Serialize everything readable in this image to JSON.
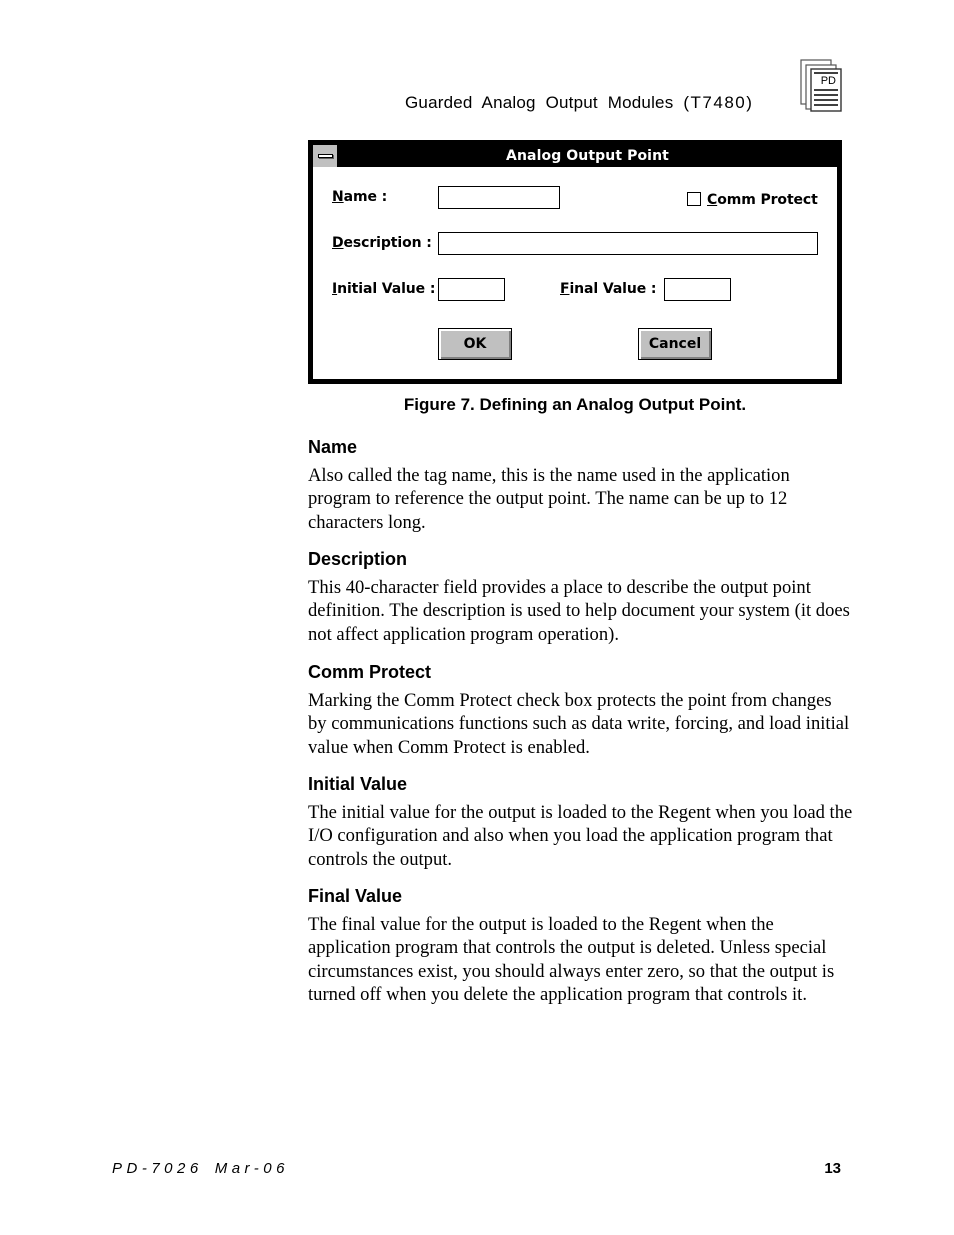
{
  "header": {
    "title": "Guarded Analog Output Modules",
    "code": "(T7480)",
    "icon": "pd-document-stack-icon",
    "icon_text": "PD"
  },
  "dialog": {
    "title": "Analog Output Point",
    "system_menu_icon": "system-menu-icon",
    "name_label": {
      "mnemonic": "N",
      "rest": "ame :"
    },
    "name_value": "",
    "description_label": {
      "mnemonic": "D",
      "rest": "escription :"
    },
    "description_value": "",
    "comm_protect_label": {
      "mnemonic": "C",
      "rest": "omm Protect"
    },
    "comm_protect_checked": false,
    "initial_value_label": {
      "mnemonic": "I",
      "rest": "nitial Value :"
    },
    "initial_value": "",
    "final_value_label": {
      "mnemonic": "F",
      "rest": "inal Value :"
    },
    "final_value": "",
    "ok_label": "OK",
    "cancel_label": "Cancel"
  },
  "caption": "Figure 7.  Defining an Analog Output Point.",
  "sections": [
    {
      "heading": "Name",
      "body": "Also called the tag name, this is the name used in the application program to reference the output point.  The name can be up to 12 characters long."
    },
    {
      "heading": "Description",
      "body": "This 40-character field provides a place to describe the output point definition.  The description is used to help document your system (it does not affect application program operation)."
    },
    {
      "heading": "Comm Protect",
      "body": "Marking the Comm Protect check box protects the point from changes by communications functions such as data write, forcing, and load initial value when Comm Protect is enabled."
    },
    {
      "heading": "Initial Value",
      "body": "The initial value for the output is loaded to the Regent when you load the I/O configuration and also when you load the application program that controls the output."
    },
    {
      "heading": "Final Value",
      "body": "The final value for the output is loaded to the Regent when the application program that controls the output is deleted. Unless special circumstances exist, you should always enter zero, so that the output is turned off when you delete the application program that controls it."
    }
  ],
  "footer": {
    "doc_id": "PD-7026",
    "date": "Mar-06",
    "page_number": "13"
  }
}
